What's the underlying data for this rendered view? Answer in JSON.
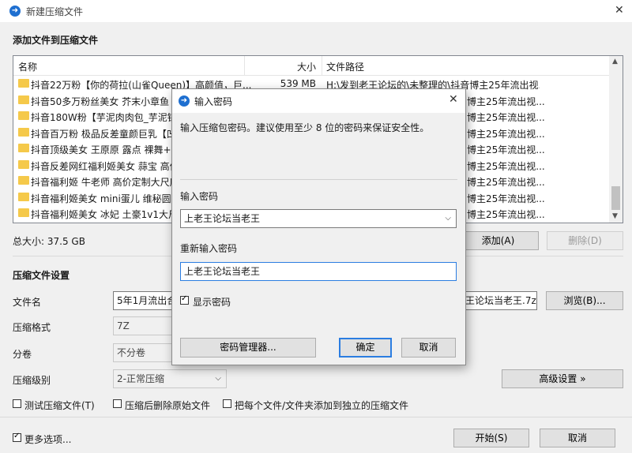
{
  "window": {
    "title": "新建压缩文件",
    "close_icon": "✕"
  },
  "add_section": {
    "heading": "添加文件到压缩文件"
  },
  "file_list": {
    "columns": {
      "name": "名称",
      "size": "大小",
      "path": "文件路径"
    },
    "rows": [
      {
        "name": "抖音22万粉【你的荷拉(山雀Queen)】高颜值，巨...",
        "size": "539 MB",
        "path": "H:\\发到老王论坛的\\未整理的\\抖音博主25年流出视..."
      },
      {
        "name": "抖音50多万粉丝美女 芥末小章鱼 ..",
        "size": "",
        "path": "博主25年流出视..."
      },
      {
        "name": "抖音180W粉【芋泥肉肉包_芋泥锅..",
        "size": "",
        "path": "博主25年流出视..."
      },
      {
        "name": "抖音百万粉 极品反差童颜巨乳【凹..",
        "size": "",
        "path": "博主25年流出视..."
      },
      {
        "name": "抖音顶级美女 王原原 露点 裸舞+附..",
        "size": "",
        "path": "博主25年流出视..."
      },
      {
        "name": "抖音反差网红福利姬美女 蒜宝 高价..",
        "size": "",
        "path": "博主25年流出视..."
      },
      {
        "name": "抖音福利姬 牛老师 高价定制大尺度..",
        "size": "",
        "path": "博主25年流出视..."
      },
      {
        "name": "抖音福利姬美女 mini蛋儿 维秘圆臀..",
        "size": "",
        "path": "博主25年流出视..."
      },
      {
        "name": "抖音福利姬美女 冰妃 土豪1v1大尺..",
        "size": "",
        "path": "博主25年流出视..."
      }
    ]
  },
  "total_size": "总大小: 37.5 GB",
  "buttons": {
    "add": "添加(A)",
    "delete": "删除(D)",
    "browse": "浏览(B)...",
    "advanced": "高级设置 »",
    "start": "开始(S)",
    "cancel": "取消"
  },
  "settings": {
    "heading": "压缩文件设置",
    "filename_label": "文件名",
    "filename_value_left": "5年1月流出合",
    "filename_value_right": "王论坛当老王.7z",
    "format_label": "压缩格式",
    "format_value": "7Z",
    "volume_label": "分卷",
    "volume_value": "不分卷",
    "level_label": "压缩级别",
    "level_value": "2-正常压缩"
  },
  "options": {
    "test": "测试压缩文件(T)",
    "delete_after": "压缩后删除原始文件",
    "separate": "把每个文件/文件夹添加到独立的压缩文件",
    "more": "更多选项..."
  },
  "password_dialog": {
    "title": "输入密码",
    "hint": "输入压缩包密码。建议使用至少 8 位的密码来保证安全性。",
    "enter_label": "输入密码",
    "enter_value": "上老王论坛当老王",
    "reenter_label": "重新输入密码",
    "reenter_value": "上老王论坛当老王",
    "show_password": "显示密码",
    "manager_button": "密码管理器...",
    "ok_button": "确定",
    "cancel_button": "取消"
  }
}
